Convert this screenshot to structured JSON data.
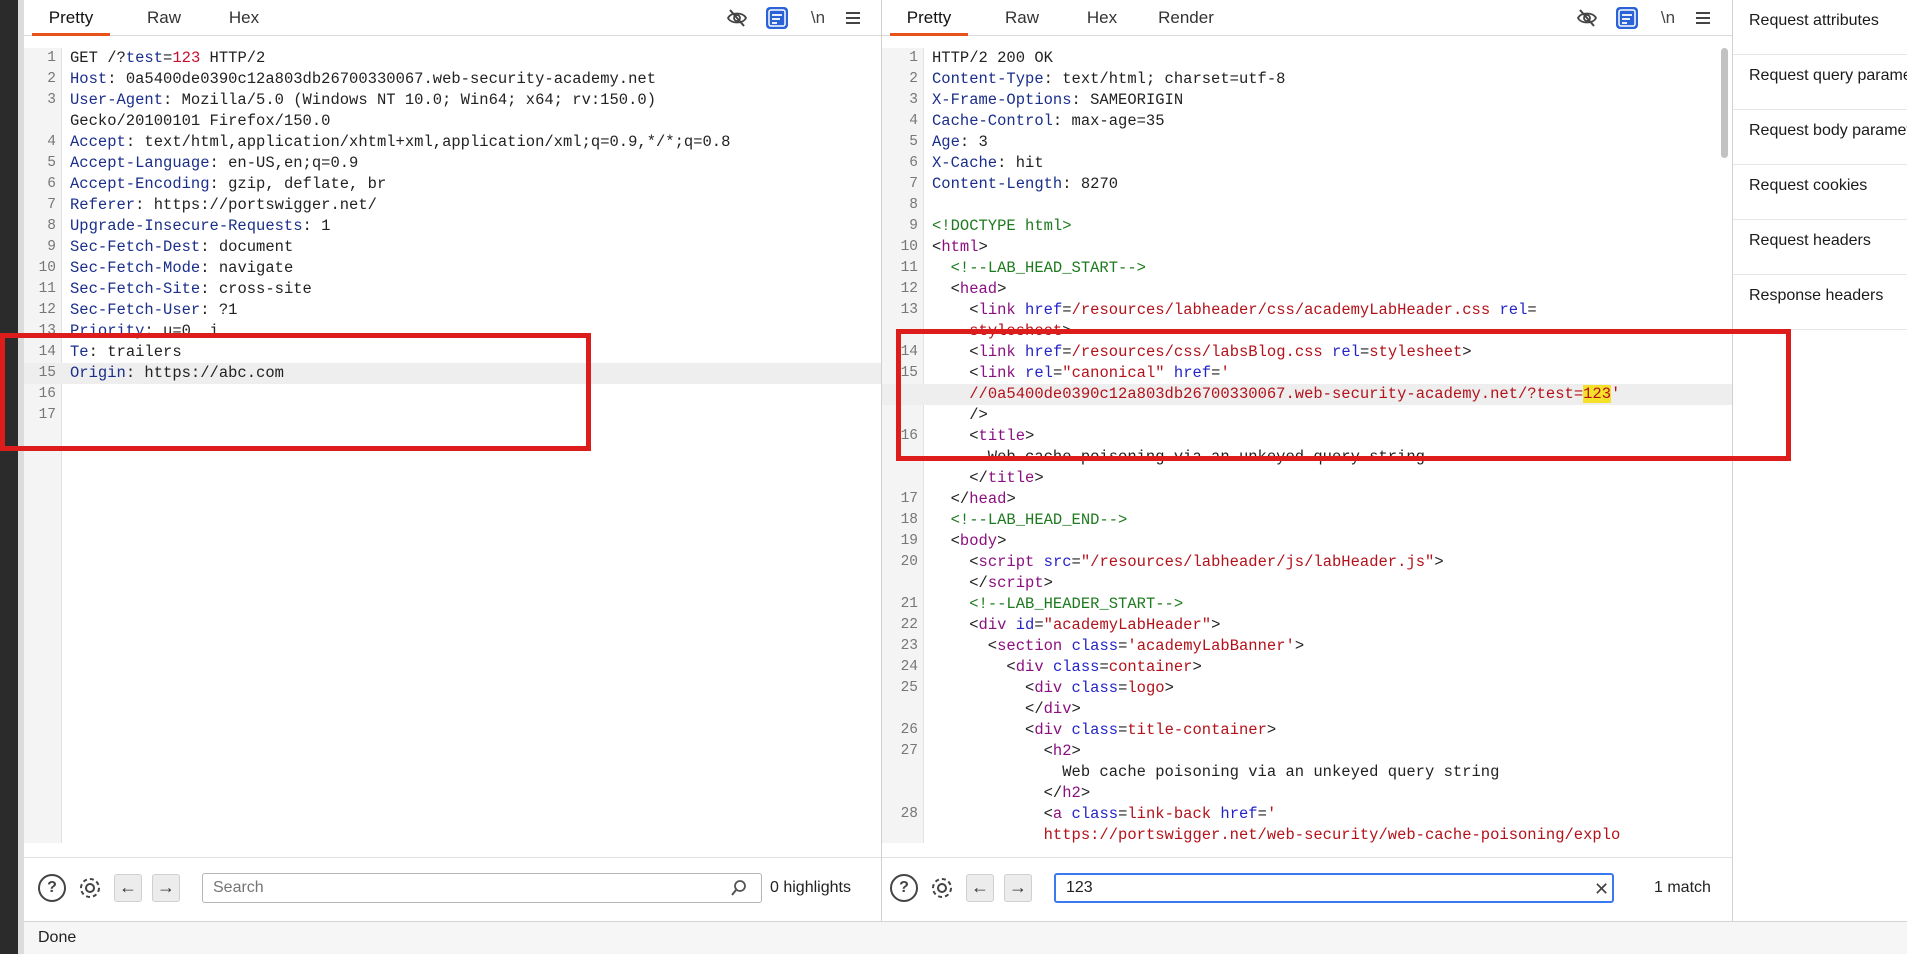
{
  "request_pane": {
    "tabs": [
      {
        "label": "Pretty",
        "active": true
      },
      {
        "label": "Raw"
      },
      {
        "label": "Hex"
      }
    ],
    "toolbar_icons": [
      "eye-slash-icon",
      "wrap-icon",
      "newline-icon",
      "menu-icon"
    ],
    "newline_label": "\\n",
    "lines": [
      {
        "n": "1",
        "parts": [
          {
            "t": "GET /?"
          },
          {
            "t": "test",
            "c": "k"
          },
          {
            "t": "="
          },
          {
            "t": "123",
            "c": "red"
          },
          {
            "t": " HTTP/2"
          }
        ]
      },
      {
        "n": "2",
        "parts": [
          {
            "t": "Host",
            "c": "k"
          },
          {
            "t": ": 0a5400de0390c12a803db26700330067.web-security-academy.net"
          }
        ]
      },
      {
        "n": "3",
        "parts": [
          {
            "t": "User-Agent",
            "c": "k"
          },
          {
            "t": ": Mozilla/5.0 (Windows NT 10.0; Win64; x64; rv:150.0)"
          }
        ]
      },
      {
        "n": "",
        "parts": [
          {
            "t": "Gecko/20100101 Firefox/150.0"
          }
        ]
      },
      {
        "n": "4",
        "parts": [
          {
            "t": "Accept",
            "c": "k"
          },
          {
            "t": ": text/html,application/xhtml+xml,application/xml;q=0.9,*/*;q=0.8"
          }
        ]
      },
      {
        "n": "5",
        "parts": [
          {
            "t": "Accept-Language",
            "c": "k"
          },
          {
            "t": ": en-US,en;q=0.9"
          }
        ]
      },
      {
        "n": "6",
        "parts": [
          {
            "t": "Accept-Encoding",
            "c": "k"
          },
          {
            "t": ": gzip, deflate, br"
          }
        ]
      },
      {
        "n": "7",
        "parts": [
          {
            "t": "Referer",
            "c": "k"
          },
          {
            "t": ": https://portswigger.net/"
          }
        ]
      },
      {
        "n": "8",
        "parts": [
          {
            "t": "Upgrade-Insecure-Requests",
            "c": "k"
          },
          {
            "t": ": 1"
          }
        ]
      },
      {
        "n": "9",
        "parts": [
          {
            "t": "Sec-Fetch-Dest",
            "c": "k"
          },
          {
            "t": ": document"
          }
        ]
      },
      {
        "n": "10",
        "parts": [
          {
            "t": "Sec-Fetch-Mode",
            "c": "k"
          },
          {
            "t": ": navigate"
          }
        ]
      },
      {
        "n": "11",
        "parts": [
          {
            "t": "Sec-Fetch-Site",
            "c": "k"
          },
          {
            "t": ": cross-site"
          }
        ]
      },
      {
        "n": "12",
        "parts": [
          {
            "t": "Sec-Fetch-User",
            "c": "k"
          },
          {
            "t": ": ?1"
          }
        ]
      },
      {
        "n": "13",
        "parts": [
          {
            "t": "Priority",
            "c": "k"
          },
          {
            "t": ": u=0, i"
          }
        ]
      },
      {
        "n": "14",
        "parts": [
          {
            "t": "Te",
            "c": "k"
          },
          {
            "t": ": trailers"
          }
        ]
      },
      {
        "n": "15",
        "parts": [
          {
            "t": "Origin",
            "c": "k"
          },
          {
            "t": ": https://abc.com"
          }
        ],
        "hl": true
      },
      {
        "n": "16",
        "parts": []
      },
      {
        "n": "17",
        "parts": []
      }
    ],
    "search_placeholder": "Search",
    "search_value": "",
    "highlights": "0 highlights"
  },
  "response_pane": {
    "tabs": [
      {
        "label": "Pretty",
        "active": true
      },
      {
        "label": "Raw"
      },
      {
        "label": "Hex"
      },
      {
        "label": "Render"
      }
    ],
    "toolbar_icons": [
      "eye-slash-icon",
      "wrap-icon",
      "newline-icon",
      "menu-icon"
    ],
    "newline_label": "\\n",
    "lines": [
      {
        "n": "1",
        "parts": [
          {
            "t": "HTTP/2 200 OK"
          }
        ]
      },
      {
        "n": "2",
        "parts": [
          {
            "t": "Content-Type",
            "c": "k"
          },
          {
            "t": ": text/html; charset=utf-8"
          }
        ]
      },
      {
        "n": "3",
        "parts": [
          {
            "t": "X-Frame-Options",
            "c": "k"
          },
          {
            "t": ": SAMEORIGIN"
          }
        ]
      },
      {
        "n": "4",
        "parts": [
          {
            "t": "Cache-Control",
            "c": "k"
          },
          {
            "t": ": max-age=35"
          }
        ]
      },
      {
        "n": "5",
        "parts": [
          {
            "t": "Age",
            "c": "k"
          },
          {
            "t": ": 3"
          }
        ]
      },
      {
        "n": "6",
        "parts": [
          {
            "t": "X-Cache",
            "c": "k"
          },
          {
            "t": ": hit"
          }
        ]
      },
      {
        "n": "7",
        "parts": [
          {
            "t": "Content-Length",
            "c": "k"
          },
          {
            "t": ": 8270"
          }
        ]
      },
      {
        "n": "8",
        "parts": []
      },
      {
        "n": "9",
        "parts": [
          {
            "t": "<!DOCTYPE html>",
            "c": "cmt"
          }
        ]
      },
      {
        "n": "10",
        "parts": [
          {
            "t": "<"
          },
          {
            "t": "html",
            "c": "tag"
          },
          {
            "t": ">"
          }
        ]
      },
      {
        "n": "11",
        "parts": [
          {
            "t": "  "
          },
          {
            "t": "<!--LAB_HEAD_START-->",
            "c": "cmt"
          }
        ]
      },
      {
        "n": "12",
        "parts": [
          {
            "t": "  <"
          },
          {
            "t": "head",
            "c": "tag"
          },
          {
            "t": ">"
          }
        ]
      },
      {
        "n": "13",
        "parts": [
          {
            "t": "    <"
          },
          {
            "t": "link",
            "c": "tag"
          },
          {
            "t": " "
          },
          {
            "t": "href",
            "c": "attr"
          },
          {
            "t": "="
          },
          {
            "t": "/resources/labheader/css/academyLabHeader.css",
            "c": "str"
          },
          {
            "t": " "
          },
          {
            "t": "rel",
            "c": "attr"
          },
          {
            "t": "="
          }
        ]
      },
      {
        "n": "",
        "parts": [
          {
            "t": "    "
          },
          {
            "t": "stylesheet",
            "c": "str"
          },
          {
            "t": ">"
          }
        ]
      },
      {
        "n": "14",
        "parts": [
          {
            "t": "    <"
          },
          {
            "t": "link",
            "c": "tag"
          },
          {
            "t": " "
          },
          {
            "t": "href",
            "c": "attr"
          },
          {
            "t": "="
          },
          {
            "t": "/resources/css/labsBlog.css",
            "c": "str"
          },
          {
            "t": " "
          },
          {
            "t": "rel",
            "c": "attr"
          },
          {
            "t": "="
          },
          {
            "t": "stylesheet",
            "c": "str"
          },
          {
            "t": ">"
          }
        ]
      },
      {
        "n": "15",
        "parts": [
          {
            "t": "    <"
          },
          {
            "t": "link",
            "c": "tag"
          },
          {
            "t": " "
          },
          {
            "t": "rel",
            "c": "attr"
          },
          {
            "t": "="
          },
          {
            "t": "\"canonical\"",
            "c": "str"
          },
          {
            "t": " "
          },
          {
            "t": "href",
            "c": "attr"
          },
          {
            "t": "="
          },
          {
            "t": "'",
            "c": "str"
          }
        ]
      },
      {
        "n": "",
        "parts": [
          {
            "t": "    "
          },
          {
            "t": "//0a5400de0390c12a803db26700330067.web-security-academy.net/?test=",
            "c": "str"
          },
          {
            "t": "123",
            "c": "str match"
          },
          {
            "t": "'",
            "c": "str"
          }
        ],
        "hl": true
      },
      {
        "n": "",
        "parts": [
          {
            "t": "    />"
          }
        ]
      },
      {
        "n": "16",
        "parts": [
          {
            "t": "    <"
          },
          {
            "t": "title",
            "c": "tag"
          },
          {
            "t": ">"
          }
        ]
      },
      {
        "n": "",
        "parts": [
          {
            "t": "      Web cache poisoning via an unkeyed query string"
          }
        ]
      },
      {
        "n": "",
        "parts": [
          {
            "t": "    </"
          },
          {
            "t": "title",
            "c": "tag"
          },
          {
            "t": ">"
          }
        ]
      },
      {
        "n": "17",
        "parts": [
          {
            "t": "  </"
          },
          {
            "t": "head",
            "c": "tag"
          },
          {
            "t": ">"
          }
        ]
      },
      {
        "n": "18",
        "parts": [
          {
            "t": "  "
          },
          {
            "t": "<!--LAB_HEAD_END-->",
            "c": "cmt"
          }
        ]
      },
      {
        "n": "19",
        "parts": [
          {
            "t": "  <"
          },
          {
            "t": "body",
            "c": "tag"
          },
          {
            "t": ">"
          }
        ]
      },
      {
        "n": "20",
        "parts": [
          {
            "t": "    <"
          },
          {
            "t": "script",
            "c": "tag"
          },
          {
            "t": " "
          },
          {
            "t": "src",
            "c": "attr"
          },
          {
            "t": "="
          },
          {
            "t": "\"/resources/labheader/js/labHeader.js\"",
            "c": "str"
          },
          {
            "t": ">"
          }
        ]
      },
      {
        "n": "",
        "parts": [
          {
            "t": "    </"
          },
          {
            "t": "script",
            "c": "tag"
          },
          {
            "t": ">"
          }
        ]
      },
      {
        "n": "21",
        "parts": [
          {
            "t": "    "
          },
          {
            "t": "<!--LAB_HEADER_START-->",
            "c": "cmt"
          }
        ]
      },
      {
        "n": "22",
        "parts": [
          {
            "t": "    <"
          },
          {
            "t": "div",
            "c": "tag"
          },
          {
            "t": " "
          },
          {
            "t": "id",
            "c": "attr"
          },
          {
            "t": "="
          },
          {
            "t": "\"academyLabHeader\"",
            "c": "str"
          },
          {
            "t": ">"
          }
        ]
      },
      {
        "n": "23",
        "parts": [
          {
            "t": "      <"
          },
          {
            "t": "section",
            "c": "tag"
          },
          {
            "t": " "
          },
          {
            "t": "class",
            "c": "attr"
          },
          {
            "t": "="
          },
          {
            "t": "'academyLabBanner'",
            "c": "str"
          },
          {
            "t": ">"
          }
        ]
      },
      {
        "n": "24",
        "parts": [
          {
            "t": "        <"
          },
          {
            "t": "div",
            "c": "tag"
          },
          {
            "t": " "
          },
          {
            "t": "class",
            "c": "attr"
          },
          {
            "t": "="
          },
          {
            "t": "container",
            "c": "str"
          },
          {
            "t": ">"
          }
        ]
      },
      {
        "n": "25",
        "parts": [
          {
            "t": "          <"
          },
          {
            "t": "div",
            "c": "tag"
          },
          {
            "t": " "
          },
          {
            "t": "class",
            "c": "attr"
          },
          {
            "t": "="
          },
          {
            "t": "logo",
            "c": "str"
          },
          {
            "t": ">"
          }
        ]
      },
      {
        "n": "",
        "parts": [
          {
            "t": "          </"
          },
          {
            "t": "div",
            "c": "tag"
          },
          {
            "t": ">"
          }
        ]
      },
      {
        "n": "26",
        "parts": [
          {
            "t": "          <"
          },
          {
            "t": "div",
            "c": "tag"
          },
          {
            "t": " "
          },
          {
            "t": "class",
            "c": "attr"
          },
          {
            "t": "="
          },
          {
            "t": "title-container",
            "c": "str"
          },
          {
            "t": ">"
          }
        ]
      },
      {
        "n": "27",
        "parts": [
          {
            "t": "            <"
          },
          {
            "t": "h2",
            "c": "tag"
          },
          {
            "t": ">"
          }
        ]
      },
      {
        "n": "",
        "parts": [
          {
            "t": "              Web cache poisoning via an unkeyed query string"
          }
        ]
      },
      {
        "n": "",
        "parts": [
          {
            "t": "            </"
          },
          {
            "t": "h2",
            "c": "tag"
          },
          {
            "t": ">"
          }
        ]
      },
      {
        "n": "28",
        "parts": [
          {
            "t": "            <"
          },
          {
            "t": "a",
            "c": "tag"
          },
          {
            "t": " "
          },
          {
            "t": "class",
            "c": "attr"
          },
          {
            "t": "="
          },
          {
            "t": "link-back",
            "c": "str"
          },
          {
            "t": " "
          },
          {
            "t": "href",
            "c": "attr"
          },
          {
            "t": "="
          },
          {
            "t": "'",
            "c": "str"
          }
        ]
      },
      {
        "n": "",
        "parts": [
          {
            "t": "            "
          },
          {
            "t": "https://portswigger.net/web-security/web-cache-poisoning/explo",
            "c": "str"
          }
        ]
      }
    ],
    "search_placeholder": "Search",
    "search_value": "123",
    "matches": "1 match"
  },
  "inspector": {
    "items": [
      "Request attributes",
      "Request query parameters",
      "Request body parameters",
      "Request cookies",
      "Request headers",
      "Response headers"
    ]
  },
  "status": "Done",
  "colors": {
    "accent": "#e8531c",
    "annotation_box": "#dd1c1c",
    "match_highlight": "#f6e12a",
    "focus": "#3b79f0"
  }
}
